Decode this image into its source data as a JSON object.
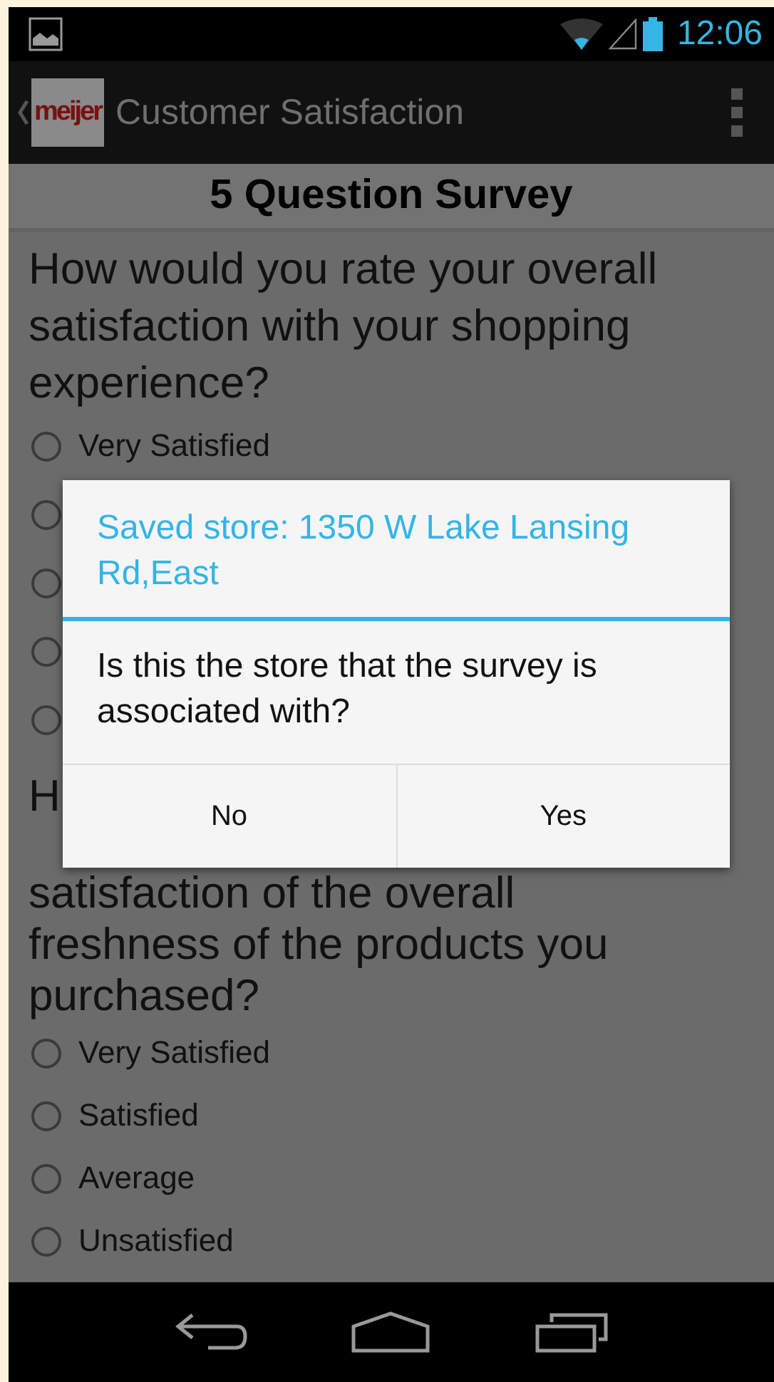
{
  "status_bar": {
    "time": "12:06"
  },
  "action_bar": {
    "logo_text": "meijer",
    "title": "Customer Satisfaction"
  },
  "survey_title": "5 Question Survey",
  "questions": [
    {
      "text_parts": [
        "How would you rate your overall satisfaction with your shopping experience?"
      ],
      "options": [
        {
          "label": "Very Satisfied",
          "selected": false
        },
        {
          "selected": false
        },
        {
          "selected": false
        },
        {
          "selected": false
        },
        {
          "selected": false
        }
      ]
    },
    {
      "text_parts": [
        "H",
        "satisfaction of the overall freshness of the products you purchased?"
      ],
      "options": [
        {
          "label": "Very Satisfied",
          "selected": false
        },
        {
          "label": "Satisfied",
          "selected": false
        },
        {
          "label": "Average",
          "selected": false
        },
        {
          "label": "Unsatisfied",
          "selected": false
        }
      ]
    }
  ],
  "dialog": {
    "title": "Saved store: 1350 W Lake Lansing Rd,East",
    "message": "Is this the store that the survey is associated with?",
    "buttons": [
      "No",
      "Yes"
    ]
  }
}
